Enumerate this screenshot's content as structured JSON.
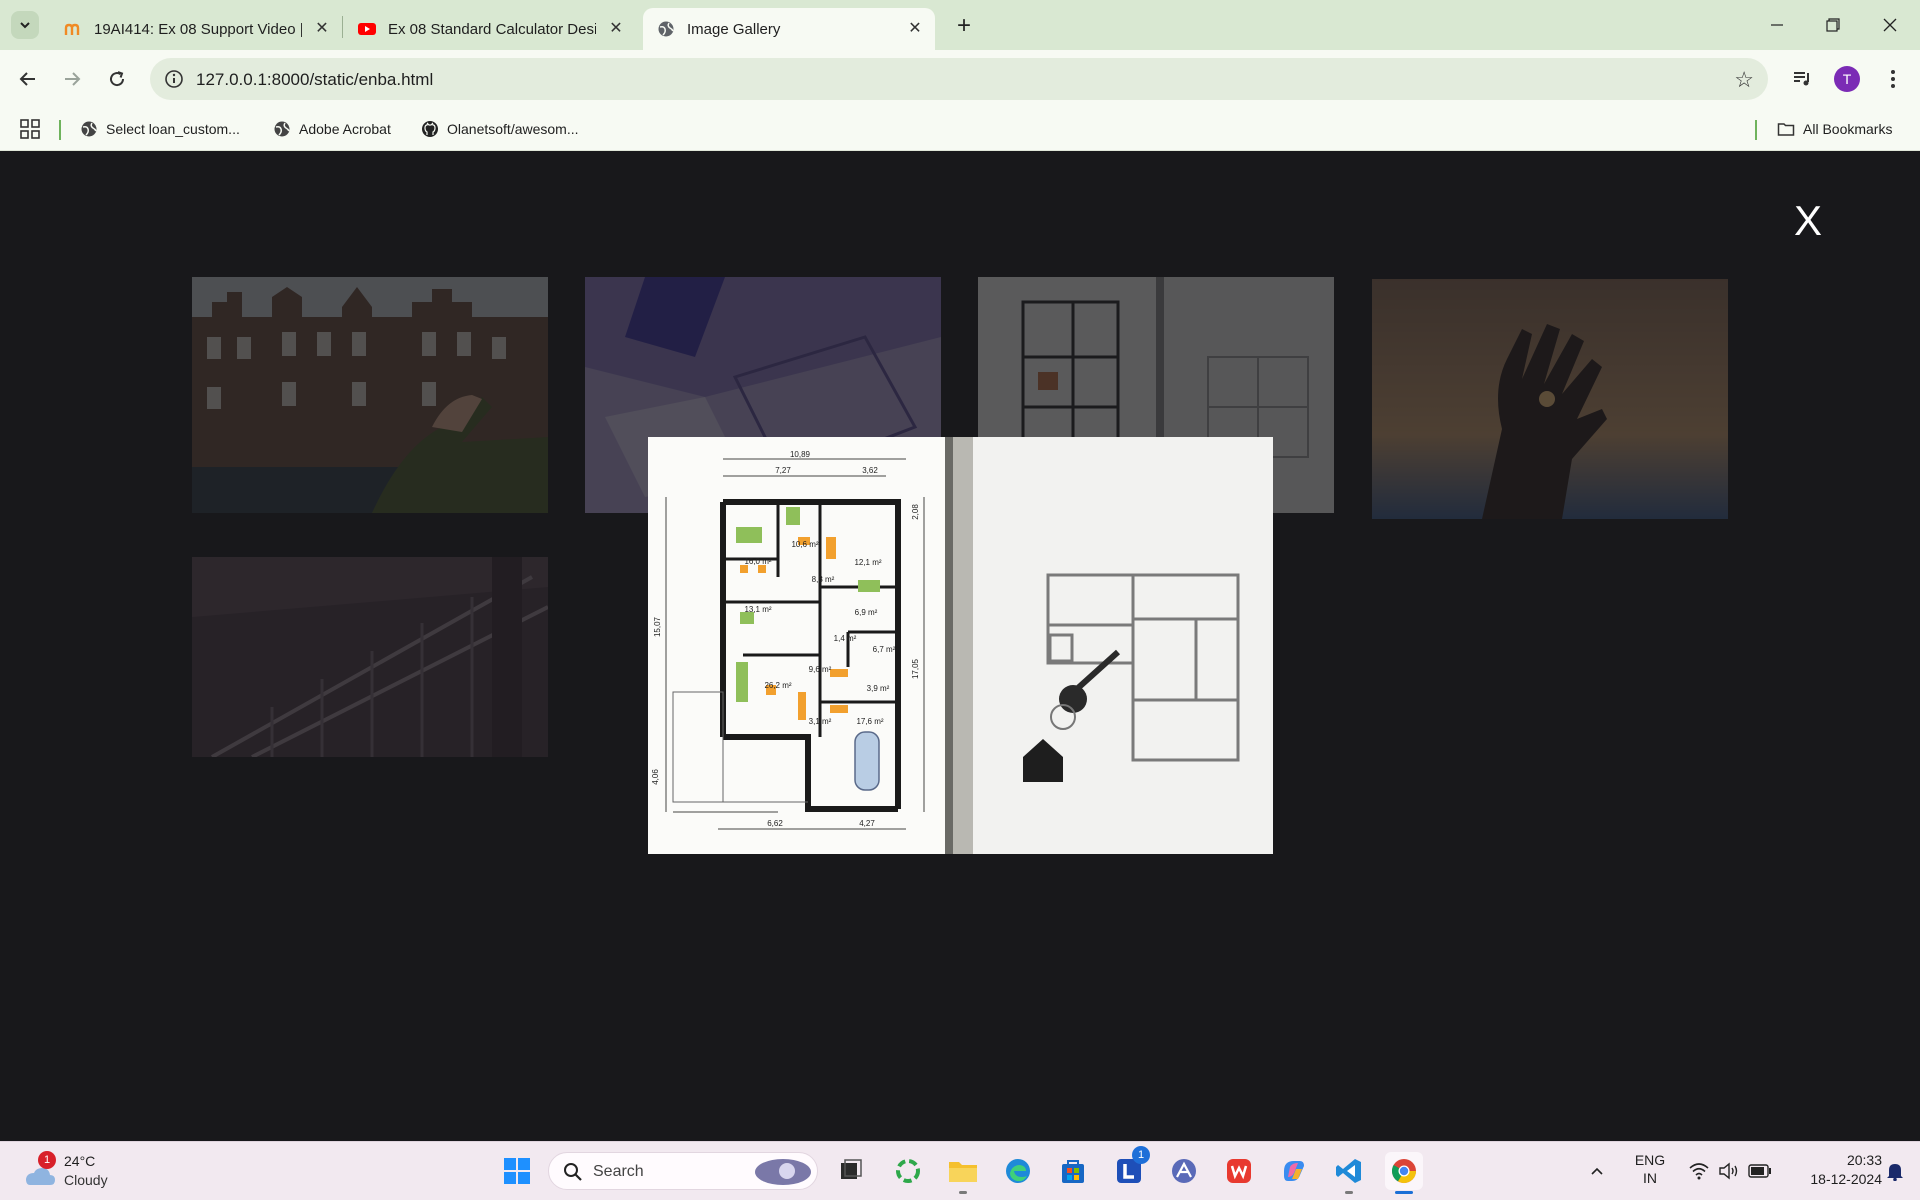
{
  "browser": {
    "tabs": [
      {
        "title": "19AI414: Ex 08 Support Video |",
        "active": false,
        "favicon": "moodle-icon"
      },
      {
        "title": "Ex 08 Standard Calculator Desig",
        "active": false,
        "favicon": "youtube-icon"
      },
      {
        "title": "Image Gallery",
        "active": true,
        "favicon": "globe-icon"
      }
    ],
    "url": "127.0.0.1:8000/static/enba.html",
    "profile_initial": "T",
    "bookmarks": [
      {
        "label": "Select loan_custom...",
        "icon": "globe-icon"
      },
      {
        "label": "Adobe Acrobat",
        "icon": "globe-icon"
      },
      {
        "label": "Olanetsoft/awesom...",
        "icon": "github-icon"
      }
    ],
    "all_bookmarks_label": "All Bookmarks",
    "accent_color": "#d9e8d2"
  },
  "gallery": {
    "close_label": "X",
    "thumbnails": [
      "houses-hand",
      "blueprint-purple",
      "floor-plans",
      "hand-sunset",
      "railing"
    ],
    "lightbox_image": "floor-plan-with-keys"
  },
  "floorplan": {
    "dims_top": [
      "10,89",
      "7,27",
      "3,62"
    ],
    "dims_bottom": [
      "6,62",
      "4,27"
    ],
    "dims_side": [
      "15,07",
      "4,06",
      "17,05",
      "2,08"
    ],
    "rooms": [
      "16,0 m²",
      "10,6 m²",
      "12,1 m²",
      "8,3 m²",
      "13,1 m²",
      "6,9 m²",
      "1,4 m²",
      "6,7 m²",
      "9,6 m²",
      "26,2 m²",
      "3,9 m²",
      "3,1 m²",
      "17,6 m²"
    ]
  },
  "taskbar": {
    "weather": {
      "badge": "1",
      "temp": "24°C",
      "condition": "Cloudy"
    },
    "search_label": "Search",
    "app_badge": "1",
    "lang_top": "ENG",
    "lang_bottom": "IN",
    "time": "20:33",
    "date": "18-12-2024"
  }
}
